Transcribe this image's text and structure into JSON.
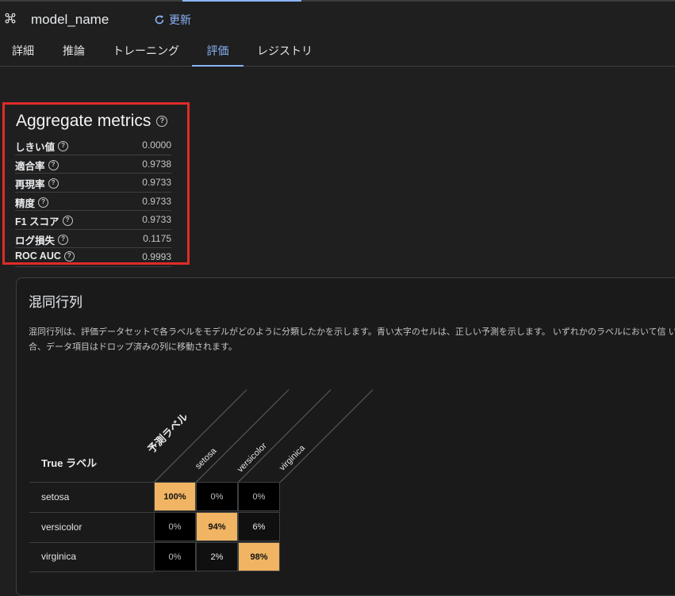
{
  "header": {
    "model_name": "model_name",
    "model_icon": "model-graph-icon",
    "refresh_label": "更新",
    "refresh_icon": "refresh-icon"
  },
  "tabs": [
    {
      "label": "詳細"
    },
    {
      "label": "推論"
    },
    {
      "label": "トレーニング"
    },
    {
      "label": "評価",
      "active": true
    },
    {
      "label": "レジストリ"
    }
  ],
  "aggregate": {
    "title": "Aggregate metrics",
    "help_icon": "help-circle-icon",
    "metrics": [
      {
        "label": "しきい値",
        "value": "0.0000"
      },
      {
        "label": "適合率",
        "value": "0.9738"
      },
      {
        "label": "再現率",
        "value": "0.9733"
      },
      {
        "label": "精度",
        "value": "0.9733"
      },
      {
        "label": "F1 スコア",
        "value": "0.9733"
      },
      {
        "label": "ログ損失",
        "value": "0.1175"
      },
      {
        "label": "ROC AUC",
        "value": "0.9993"
      }
    ],
    "highlight_color": "#e12b27"
  },
  "confusion": {
    "title": "混同行列",
    "description": "混同行列は、評価データセットで各ラベルをモデルがどのように分類したかを示します。青い太字のセルは、正しい予測を示します。 いずれかのラベルにおいて信 い場合、データ項目はドロップ済みの列に移動されます。",
    "true_label": "True ラベル",
    "predicted_label": "予測ラベル",
    "columns": [
      "setosa",
      "versicolor",
      "virginica"
    ],
    "rows": [
      {
        "label": "setosa",
        "cells": [
          "100%",
          "0%",
          "0%"
        ]
      },
      {
        "label": "versicolor",
        "cells": [
          "0%",
          "94%",
          "6%"
        ]
      },
      {
        "label": "virginica",
        "cells": [
          "0%",
          "2%",
          "98%"
        ]
      }
    ],
    "diag_color": "#f0b462"
  }
}
